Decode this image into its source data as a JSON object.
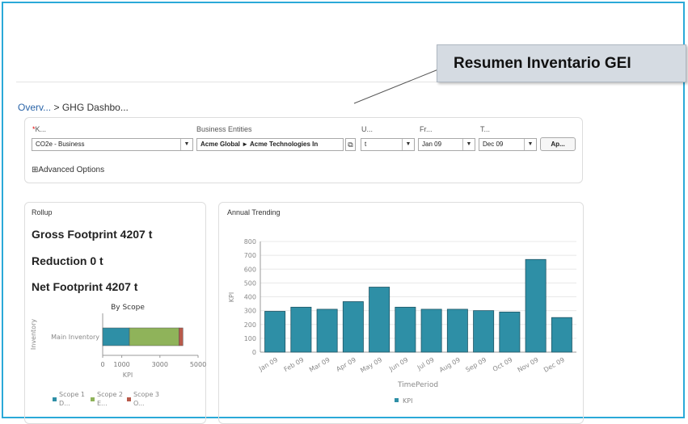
{
  "callout": {
    "title": "Resumen Inventario GEI"
  },
  "breadcrumb": {
    "first": "Overv...",
    "separator": ">",
    "second": "GHG Dashbo..."
  },
  "filters": {
    "kpi": {
      "label": "K...",
      "value": "CO2e - Business"
    },
    "entities": {
      "label": "Business Entities",
      "value": "Acme Global ► Acme Technologies In"
    },
    "unit": {
      "label": "U...",
      "value": "t"
    },
    "from": {
      "label": "Fr...",
      "value": "Jan 09"
    },
    "to": {
      "label": "T...",
      "value": "Dec 09"
    },
    "apply_label": "Ap...",
    "advanced_label": "Advanced Options",
    "required_marker": "*"
  },
  "rollup": {
    "title": "Rollup",
    "gross": "Gross Footprint 4207 t",
    "reduction": "Reduction 0 t",
    "net": "Net Footprint 4207 t"
  },
  "colors": {
    "teal": "#2e8fa6",
    "green": "#8fb35a",
    "red": "#b85a4a",
    "frame": "#2aa9d8"
  },
  "chart_data": [
    {
      "type": "bar",
      "orientation": "horizontal",
      "stacked": true,
      "title": "By Scope",
      "ylabel": "Inventory",
      "xlabel": "KPI",
      "categories": [
        "Main Inventory"
      ],
      "series": [
        {
          "name": "Scope 1 - D...",
          "values": [
            1400
          ],
          "color": "#2e8fa6"
        },
        {
          "name": "Scope 2 - E...",
          "values": [
            2600
          ],
          "color": "#8fb35a"
        },
        {
          "name": "Scope 3 - O...",
          "values": [
            207
          ],
          "color": "#b85a4a"
        }
      ],
      "xlim": [
        0,
        5000
      ],
      "xticks": [
        "0",
        "1000",
        "3000",
        "5000"
      ],
      "legend": "bottom"
    },
    {
      "type": "bar",
      "title": "Annual Trending",
      "xlabel": "TimePeriod",
      "ylabel": "KPI",
      "categories": [
        "Jan 09",
        "Feb 09",
        "Mar 09",
        "Apr 09",
        "May 09",
        "Jun 09",
        "Jul 09",
        "Aug 09",
        "Sep 09",
        "Oct 09",
        "Nov 09",
        "Dec 09"
      ],
      "series": [
        {
          "name": "KPI",
          "values": [
            295,
            325,
            310,
            365,
            470,
            325,
            310,
            310,
            300,
            290,
            670,
            250
          ],
          "color": "#2e8fa6"
        }
      ],
      "ylim": [
        0,
        800
      ],
      "yticks": [
        "0",
        "100",
        "200",
        "300",
        "400",
        "500",
        "600",
        "700",
        "800"
      ],
      "grid": true,
      "legend": "bottom"
    }
  ]
}
